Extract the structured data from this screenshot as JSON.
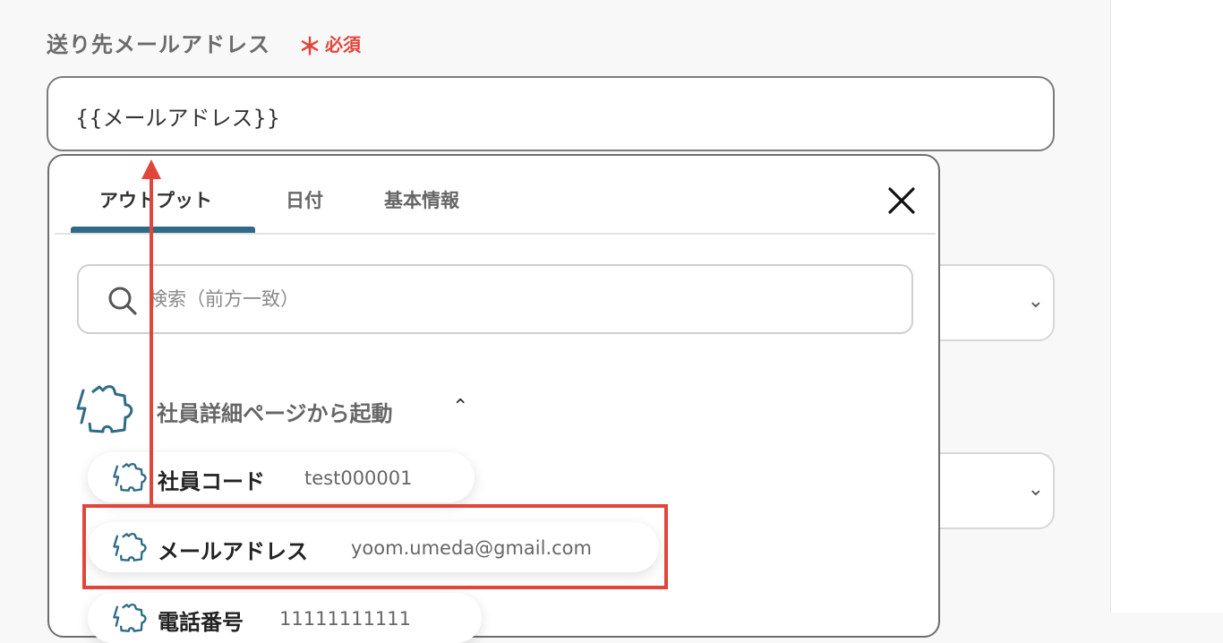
{
  "field": {
    "label": "送り先メールアドレス",
    "required_mark": "＊",
    "required_text": "必須",
    "value": "{{メールアドレス}}"
  },
  "dropdown": {
    "tabs": [
      {
        "label": "アウトプット",
        "active": true
      },
      {
        "label": "日付",
        "active": false
      },
      {
        "label": "基本情報",
        "active": false
      }
    ],
    "search_placeholder": "検索（前方一致）",
    "group": {
      "label": "社員詳細ページから起動",
      "icon": "puzzle-lightning-icon",
      "expanded": true
    },
    "items": [
      {
        "key": "社員コード",
        "value": "test000001"
      },
      {
        "key": "メールアドレス",
        "value": "yoom.umeda@gmail.com"
      },
      {
        "key": "電話番号",
        "value": "11111111111"
      }
    ]
  },
  "colors": {
    "accent": "#2f6a86",
    "required": "#e2453a",
    "highlight": "#e2453a"
  }
}
